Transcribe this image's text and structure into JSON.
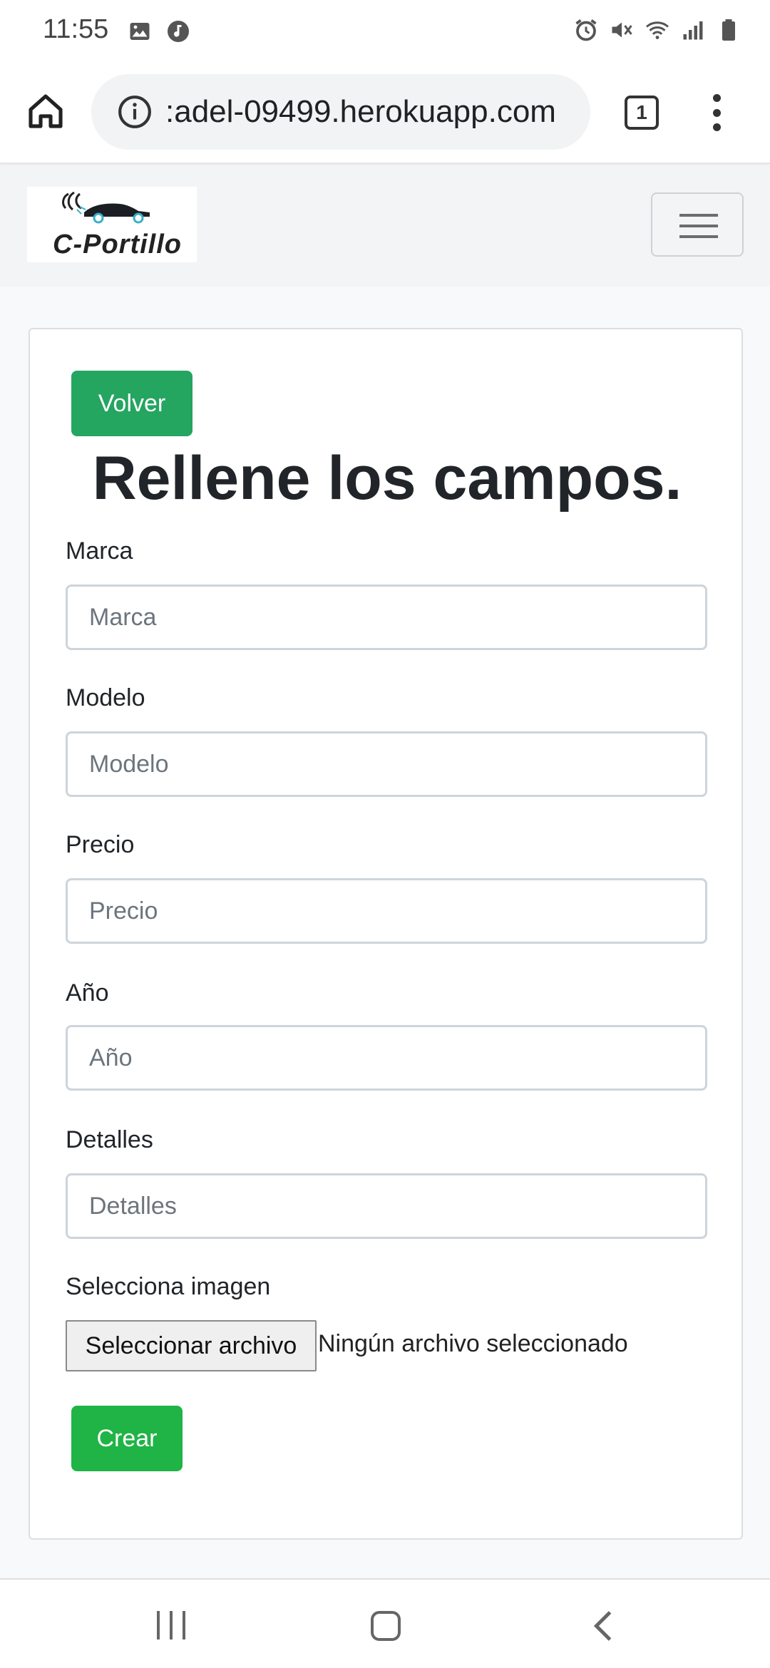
{
  "status_bar": {
    "time": "11:55",
    "left_icons": [
      "image-icon",
      "music-icon"
    ],
    "right_icons": [
      "alarm-icon",
      "mute-icon",
      "wifi-icon",
      "signal-icon",
      "battery-icon"
    ]
  },
  "browser": {
    "url": ":adel-09499.herokuapp.com",
    "tab_count": "1"
  },
  "navbar": {
    "logo_text": "C-Portillo"
  },
  "form": {
    "back_label": "Volver",
    "title": "Rellene los campos.",
    "fields": [
      {
        "label": "Marca",
        "placeholder": "Marca"
      },
      {
        "label": "Modelo",
        "placeholder": "Modelo"
      },
      {
        "label": "Precio",
        "placeholder": "Precio"
      },
      {
        "label": "Año",
        "placeholder": "Año"
      },
      {
        "label": "Detalles",
        "placeholder": "Detalles"
      }
    ],
    "image_label": "Selecciona imagen",
    "file_button_label": "Seleccionar archivo",
    "file_status": "Ningún archivo seleccionado",
    "submit_label": "Crear"
  },
  "colors": {
    "volver_button": "#24a560",
    "crear_button": "#1fb445"
  }
}
